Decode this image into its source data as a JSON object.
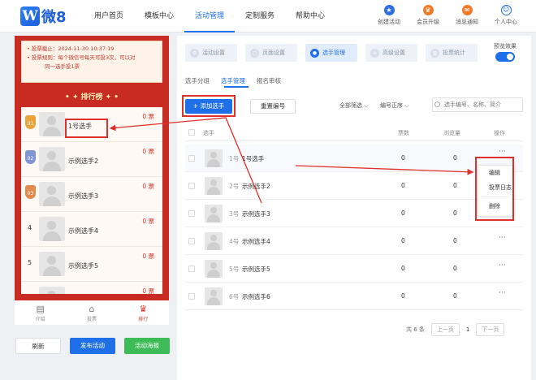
{
  "header": {
    "logo_mark": "W",
    "logo_text": "微8",
    "nav": [
      "用户首页",
      "模板中心",
      "活动管理",
      "定制服务",
      "帮助中心"
    ],
    "active_nav": "活动管理",
    "actions": [
      {
        "label": "创建活动",
        "icon": "star-icon",
        "color": "#2d6fe0"
      },
      {
        "label": "会员升级",
        "icon": "crown-icon",
        "color": "#f07a2a"
      },
      {
        "label": "消息通知",
        "icon": "mail-icon",
        "color": "#f07a2a"
      },
      {
        "label": "个人中心",
        "icon": "user-icon",
        "color": "#1f6fe8"
      }
    ]
  },
  "preview": {
    "notice_line1": "• 投票截止：2024-11-30 10:37:19",
    "notice_line2": "• 投票规则：每个微信号每天可投3次，可以对",
    "notice_line3": "同一选手投1票",
    "rank_title": "• ✦ 排行榜 ✦ •",
    "players": [
      {
        "rank": "01",
        "name": "1号选手",
        "votes": "0 票"
      },
      {
        "rank": "02",
        "name": "示例选手2",
        "votes": "0 票"
      },
      {
        "rank": "03",
        "name": "示例选手3",
        "votes": "0 票"
      },
      {
        "rank": "4",
        "name": "示例选手4",
        "votes": "0 票"
      },
      {
        "rank": "5",
        "name": "示例选手5",
        "votes": "0 票"
      },
      {
        "rank": "",
        "name": "",
        "votes": "0 票"
      }
    ],
    "tabs": [
      "介绍",
      "投票",
      "排行"
    ],
    "buttons": {
      "refresh": "刷新",
      "publish": "发布活动",
      "poster": "活动海报"
    }
  },
  "main": {
    "steps": [
      "活动设置",
      "页面设置",
      "选手管理",
      "高级设置",
      "投票统计"
    ],
    "active_step": "选手管理",
    "preview_label": "预览效果",
    "subtabs": [
      "选手分组",
      "选手管理",
      "报名审核"
    ],
    "add_button": "+ 添加选手",
    "renumber_button": "重置编号",
    "filter": "全部筛选 ⌵",
    "sort": "编号正序 ⌵",
    "search_placeholder": "选手编号、名称、简介",
    "columns": {
      "player": "选手",
      "votes": "票数",
      "views": "浏览量",
      "ops": "操作"
    },
    "rows": [
      {
        "no": "1号",
        "name": "1号选手",
        "votes": "0",
        "views": "0",
        "more": "···"
      },
      {
        "no": "2号",
        "name": "示例选手2",
        "votes": "0",
        "views": "0",
        "more": "···"
      },
      {
        "no": "3号",
        "name": "示例选手3",
        "votes": "0",
        "views": "0",
        "more": "···"
      },
      {
        "no": "4号",
        "name": "示例选手4",
        "votes": "0",
        "views": "0",
        "more": "···"
      },
      {
        "no": "5号",
        "name": "示例选手5",
        "votes": "0",
        "views": "0",
        "more": "···"
      },
      {
        "no": "6号",
        "name": "示例选手6",
        "votes": "0",
        "views": "0",
        "more": "···"
      }
    ],
    "menu": [
      "编辑",
      "投票日志",
      "删除"
    ],
    "pager": {
      "total": "共 6 条",
      "prev": "上一页",
      "page": "1",
      "next": "下一页"
    }
  },
  "colors": {
    "primary": "#1f6fe8",
    "annotation": "#e0302b",
    "preview_bg": "#c72b22"
  }
}
